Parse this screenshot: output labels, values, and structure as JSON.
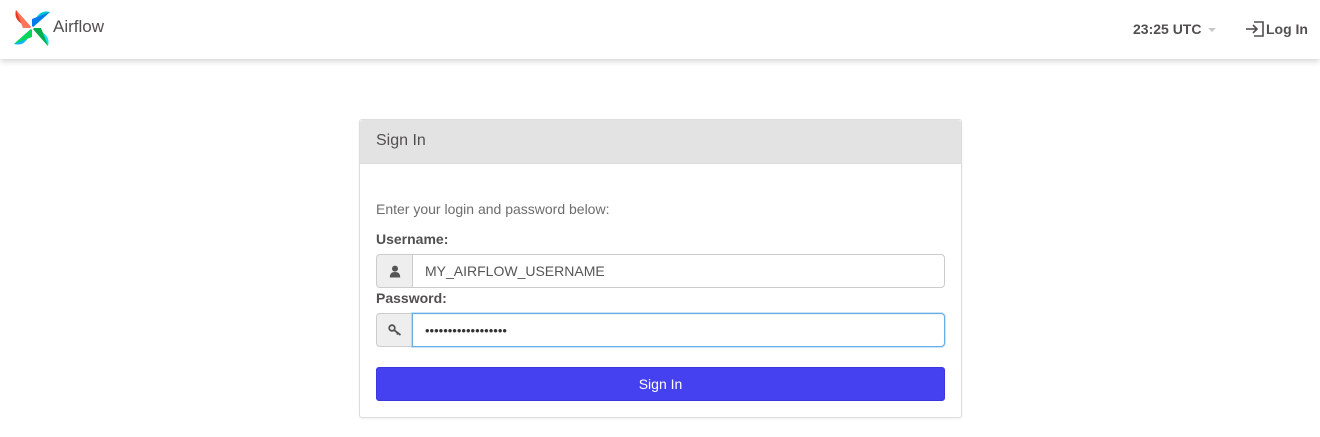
{
  "navbar": {
    "brand_name": "Airflow",
    "clock": "23:25 UTC",
    "login_label": "Log In"
  },
  "panel": {
    "title": "Sign In",
    "hint": "Enter your login and password below:",
    "username_label": "Username:",
    "username_value": "MY_AIRFLOW_USERNAME",
    "password_label": "Password:",
    "password_mask": "••••••••••••••••••",
    "submit_label": "Sign In"
  },
  "colors": {
    "primary_button": "#4540f0",
    "navbar_bg": "#ffffff",
    "panel_heading_bg": "#e3e3e3",
    "text": "#51504f",
    "focus_border": "#66afe9"
  },
  "icons": {
    "brand": "airflow-pinwheel-logo",
    "clock_dropdown": "caret-down-icon",
    "login": "sign-in-icon",
    "username": "user-icon",
    "password": "key-icon"
  }
}
